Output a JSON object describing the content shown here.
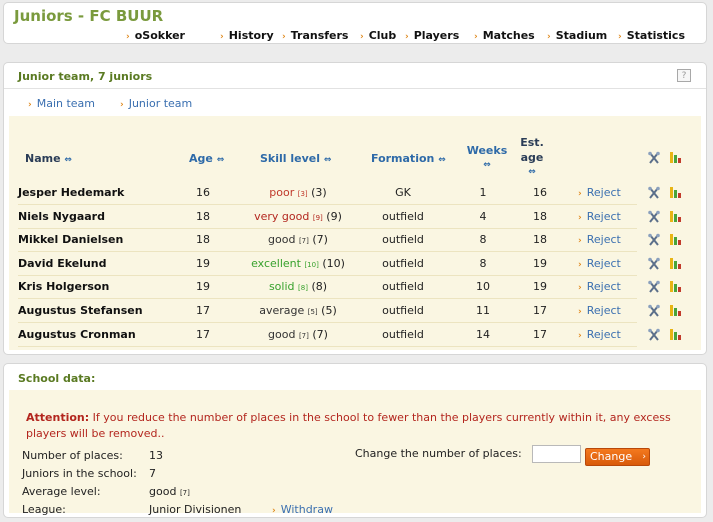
{
  "header": {
    "title": "Juniors - FC BUUR",
    "nav": [
      "oSokker",
      "History",
      "Transfers",
      "Club",
      "Players",
      "Matches",
      "Stadium",
      "Statistics"
    ]
  },
  "junior_panel": {
    "title": "Junior team, 7 juniors",
    "help": "?",
    "links": [
      "Main team",
      "Junior team"
    ],
    "columns": {
      "name": "Name",
      "age": "Age",
      "skill": "Skill level",
      "formation": "Formation",
      "weeks_line1": "Weeks",
      "est_line1": "Est.",
      "est_line2": "age"
    },
    "players": [
      {
        "name": "Jesper Hedemark",
        "age": "16",
        "skill": "poor",
        "skill_small": "[3]",
        "skill_num": "(3)",
        "formation": "GK",
        "weeks": "1",
        "est_age": "16",
        "action": "Reject"
      },
      {
        "name": "Niels Nygaard",
        "age": "18",
        "skill": "very good",
        "skill_small": "[9]",
        "skill_num": "(9)",
        "formation": "outfield",
        "weeks": "4",
        "est_age": "18",
        "action": "Reject"
      },
      {
        "name": "Mikkel Danielsen",
        "age": "18",
        "skill": "good",
        "skill_small": "[7]",
        "skill_num": "(7)",
        "formation": "outfield",
        "weeks": "8",
        "est_age": "18",
        "action": "Reject"
      },
      {
        "name": "David Ekelund",
        "age": "19",
        "skill": "excellent",
        "skill_small": "[10]",
        "skill_num": "(10)",
        "formation": "outfield",
        "weeks": "8",
        "est_age": "19",
        "action": "Reject"
      },
      {
        "name": "Kris Holgerson",
        "age": "19",
        "skill": "solid",
        "skill_small": "[8]",
        "skill_num": "(8)",
        "formation": "outfield",
        "weeks": "10",
        "est_age": "19",
        "action": "Reject"
      },
      {
        "name": "Augustus Stefansen",
        "age": "17",
        "skill": "average",
        "skill_small": "[5]",
        "skill_num": "(5)",
        "formation": "outfield",
        "weeks": "11",
        "est_age": "17",
        "action": "Reject"
      },
      {
        "name": "Augustus Cronman",
        "age": "17",
        "skill": "good",
        "skill_small": "[7]",
        "skill_num": "(7)",
        "formation": "outfield",
        "weeks": "14",
        "est_age": "17",
        "action": "Reject"
      }
    ]
  },
  "school_panel": {
    "title": "School data:",
    "attention_label": "Attention:",
    "attention_text": "If you reduce the number of places in the school to fewer than the players currently within it, any excess players will be removed..",
    "places_label": "Number of places:",
    "places_value": "13",
    "juniors_label": "Juniors in the school:",
    "juniors_value": "7",
    "level_label": "Average level:",
    "level_value": "good",
    "level_small": "[7]",
    "league_label": "League:",
    "league_value": "Junior Divisionen",
    "withdraw_label": "Withdraw",
    "change_label": "Change the number of places:",
    "change_input_value": "",
    "change_button": "Change"
  }
}
